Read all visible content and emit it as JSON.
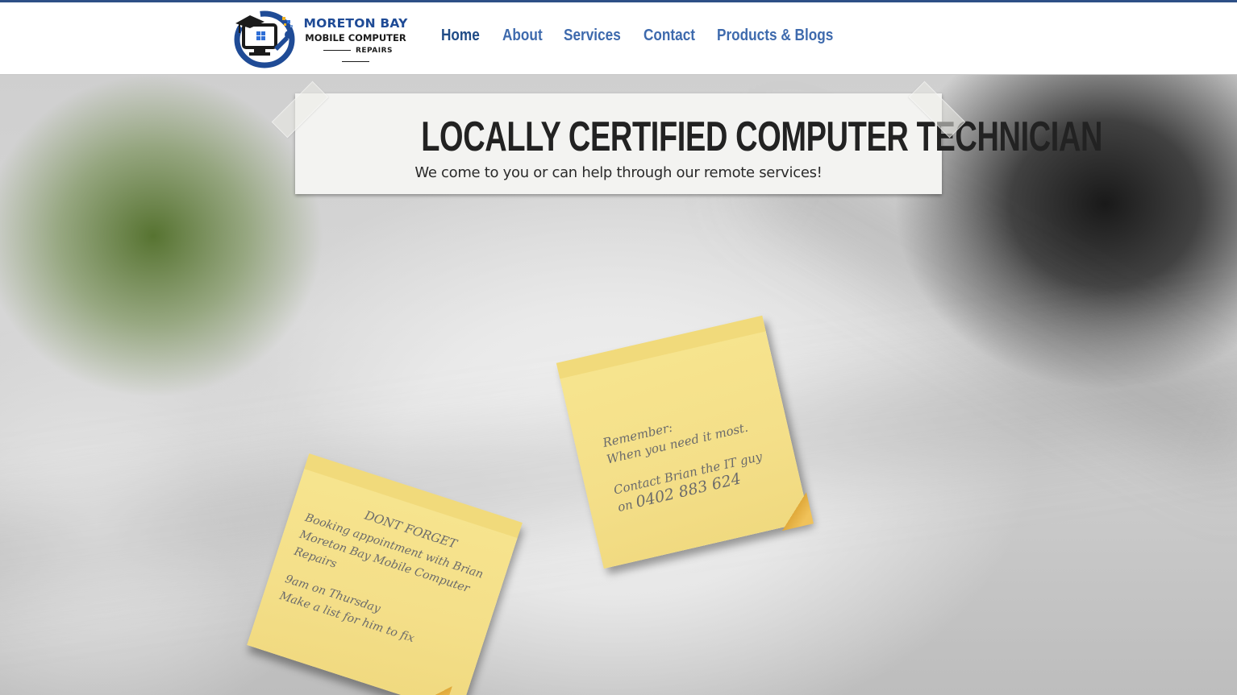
{
  "brand": {
    "line1": "MORETON BAY",
    "line2": "MOBILE COMPUTER",
    "line3": "REPAIRS",
    "colors": {
      "primary": "#1f4b96",
      "nav": "#3e6aad",
      "accent": "#f0b323"
    },
    "icon": "monitor-wrench-logo-icon"
  },
  "nav": {
    "items": [
      {
        "label": "Home",
        "active": true
      },
      {
        "label": "About",
        "active": false
      },
      {
        "label": "Services",
        "active": false
      },
      {
        "label": "Contact",
        "active": false
      },
      {
        "label": "Products & Blogs",
        "active": false
      }
    ]
  },
  "hero": {
    "title": "LOCALLY CERTIFIED COMPUTER TECHNICIAN",
    "subtitle": "We come to you or can help through our remote services!"
  },
  "notes": {
    "reminder": {
      "line1": "Remember:",
      "line2": "When you need it most.",
      "line3": "Contact Brian the IT guy",
      "line4": "on",
      "phone": "0402 883 624"
    },
    "booking": {
      "heading": "DONT FORGET",
      "line1": "Booking appointment with Brian",
      "line2": "Moreton Bay Mobile Computer Repairs",
      "line3": "9am on Thursday",
      "line4": "Make a list for him to fix"
    }
  }
}
